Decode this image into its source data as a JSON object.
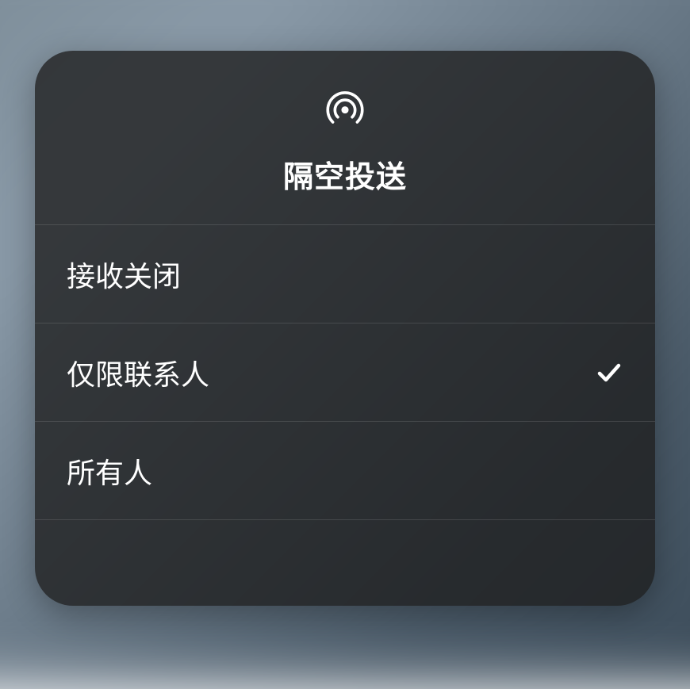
{
  "panel": {
    "title": "隔空投送",
    "icon": "airdrop-icon"
  },
  "options": [
    {
      "label": "接收关闭",
      "selected": false
    },
    {
      "label": "仅限联系人",
      "selected": true
    },
    {
      "label": "所有人",
      "selected": false
    }
  ]
}
